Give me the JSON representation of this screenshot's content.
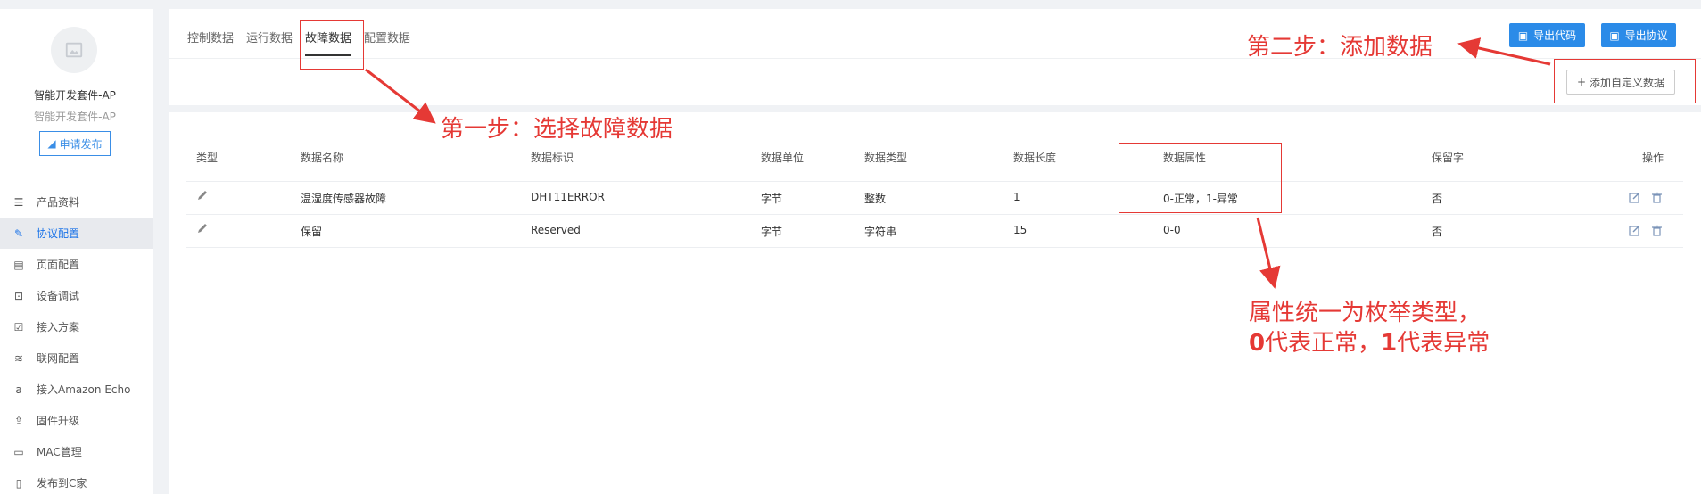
{
  "sidebar": {
    "product_name": "智能开发套件-AP",
    "product_sub": "智能开发套件-AP",
    "publish_label": "申请发布",
    "items": [
      {
        "label": "产品资料",
        "icon": "list-icon"
      },
      {
        "label": "协议配置",
        "icon": "edit-icon",
        "active": true
      },
      {
        "label": "页面配置",
        "icon": "page-icon"
      },
      {
        "label": "设备调试",
        "icon": "debug-icon"
      },
      {
        "label": "接入方案",
        "icon": "check-icon"
      },
      {
        "label": "联网配置",
        "icon": "wifi-icon"
      },
      {
        "label": "接入Amazon Echo",
        "icon": "amazon-icon"
      },
      {
        "label": "固件升级",
        "icon": "upload-icon"
      },
      {
        "label": "MAC管理",
        "icon": "monitor-icon"
      },
      {
        "label": "发布到C家",
        "icon": "phone-icon"
      }
    ]
  },
  "tabs": [
    "控制数据",
    "运行数据",
    "故障数据",
    "配置数据"
  ],
  "active_tab": "故障数据",
  "toolbar": {
    "export_code": "导出代码",
    "export_protocol": "导出协议",
    "add_custom": "添加自定义数据"
  },
  "table": {
    "headers": [
      "类型",
      "数据名称",
      "数据标识",
      "数据单位",
      "数据类型",
      "数据长度",
      "数据属性",
      "保留字",
      "操作"
    ],
    "rows": [
      [
        "",
        "温湿度传感器故障",
        "DHT11ERROR",
        "字节",
        "整数",
        "1",
        "0-正常，1-异常",
        "否"
      ],
      [
        "",
        "保留",
        "Reserved",
        "字节",
        "字符串",
        "15",
        "0-0",
        "否"
      ]
    ]
  },
  "annotations": {
    "step1": "第一步：选择故障数据",
    "step2": "第二步：添加数据",
    "note_line1": "属性统一为枚举类型，",
    "note_line2_a": "0",
    "note_line2_b": "代表正常，",
    "note_line2_c": "1",
    "note_line2_d": "代表异常"
  },
  "colors": {
    "accent": "#2b8be8",
    "annotation": "#e53935",
    "active_nav_bg": "#e8eaee"
  }
}
